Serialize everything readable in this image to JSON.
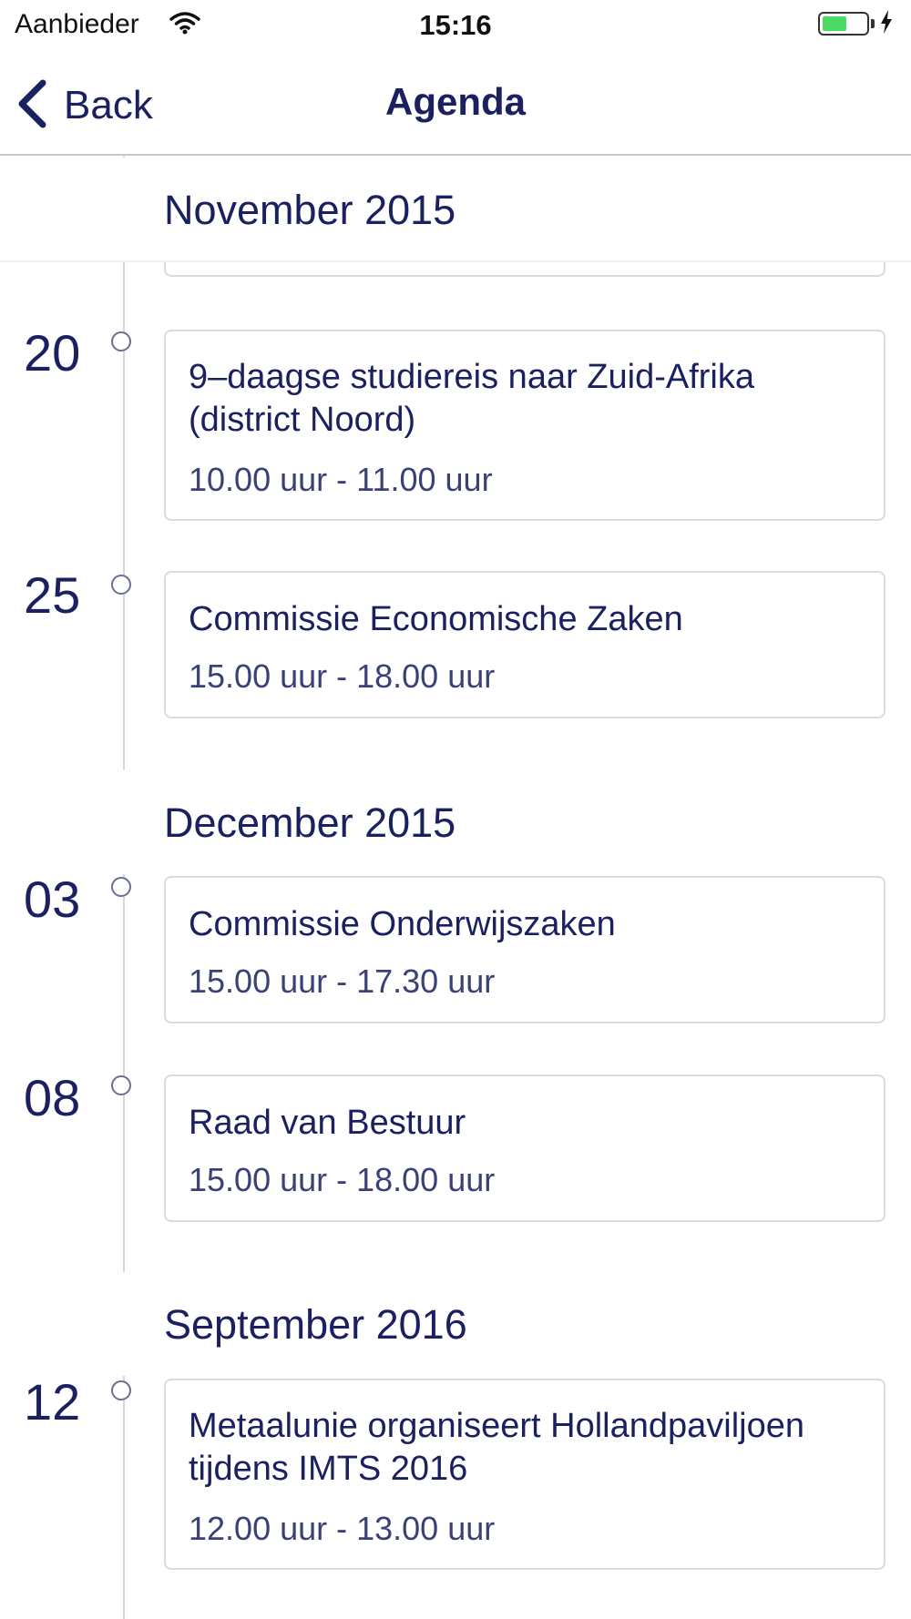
{
  "status_bar": {
    "carrier": "Aanbieder",
    "time": "15:16",
    "battery_level_percent": 55,
    "battery_color": "#4cd964"
  },
  "nav": {
    "back_label": "Back",
    "title": "Agenda"
  },
  "colors": {
    "accent": "#1b2160",
    "divider": "#d8dae1"
  },
  "agenda": {
    "months": [
      {
        "label": "November 2015",
        "events": [
          {
            "day": "20",
            "title": "9–daagse studiereis naar Zuid-Afrika (district Noord)",
            "time": "10.00 uur -  11.00 uur"
          },
          {
            "day": "25",
            "title": "Commissie Economische Zaken",
            "time": "15.00 uur -  18.00 uur"
          }
        ]
      },
      {
        "label": "December 2015",
        "events": [
          {
            "day": "03",
            "title": "Commissie Onderwijszaken",
            "time": "15.00 uur -  17.30 uur"
          },
          {
            "day": "08",
            "title": "Raad van Bestuur",
            "time": "15.00 uur -  18.00 uur"
          }
        ]
      },
      {
        "label": "September 2016",
        "events": [
          {
            "day": "12",
            "title": "Metaalunie organiseert Hollandpaviljoen tijdens IMTS 2016",
            "time": "12.00 uur -  13.00 uur"
          }
        ]
      }
    ]
  }
}
